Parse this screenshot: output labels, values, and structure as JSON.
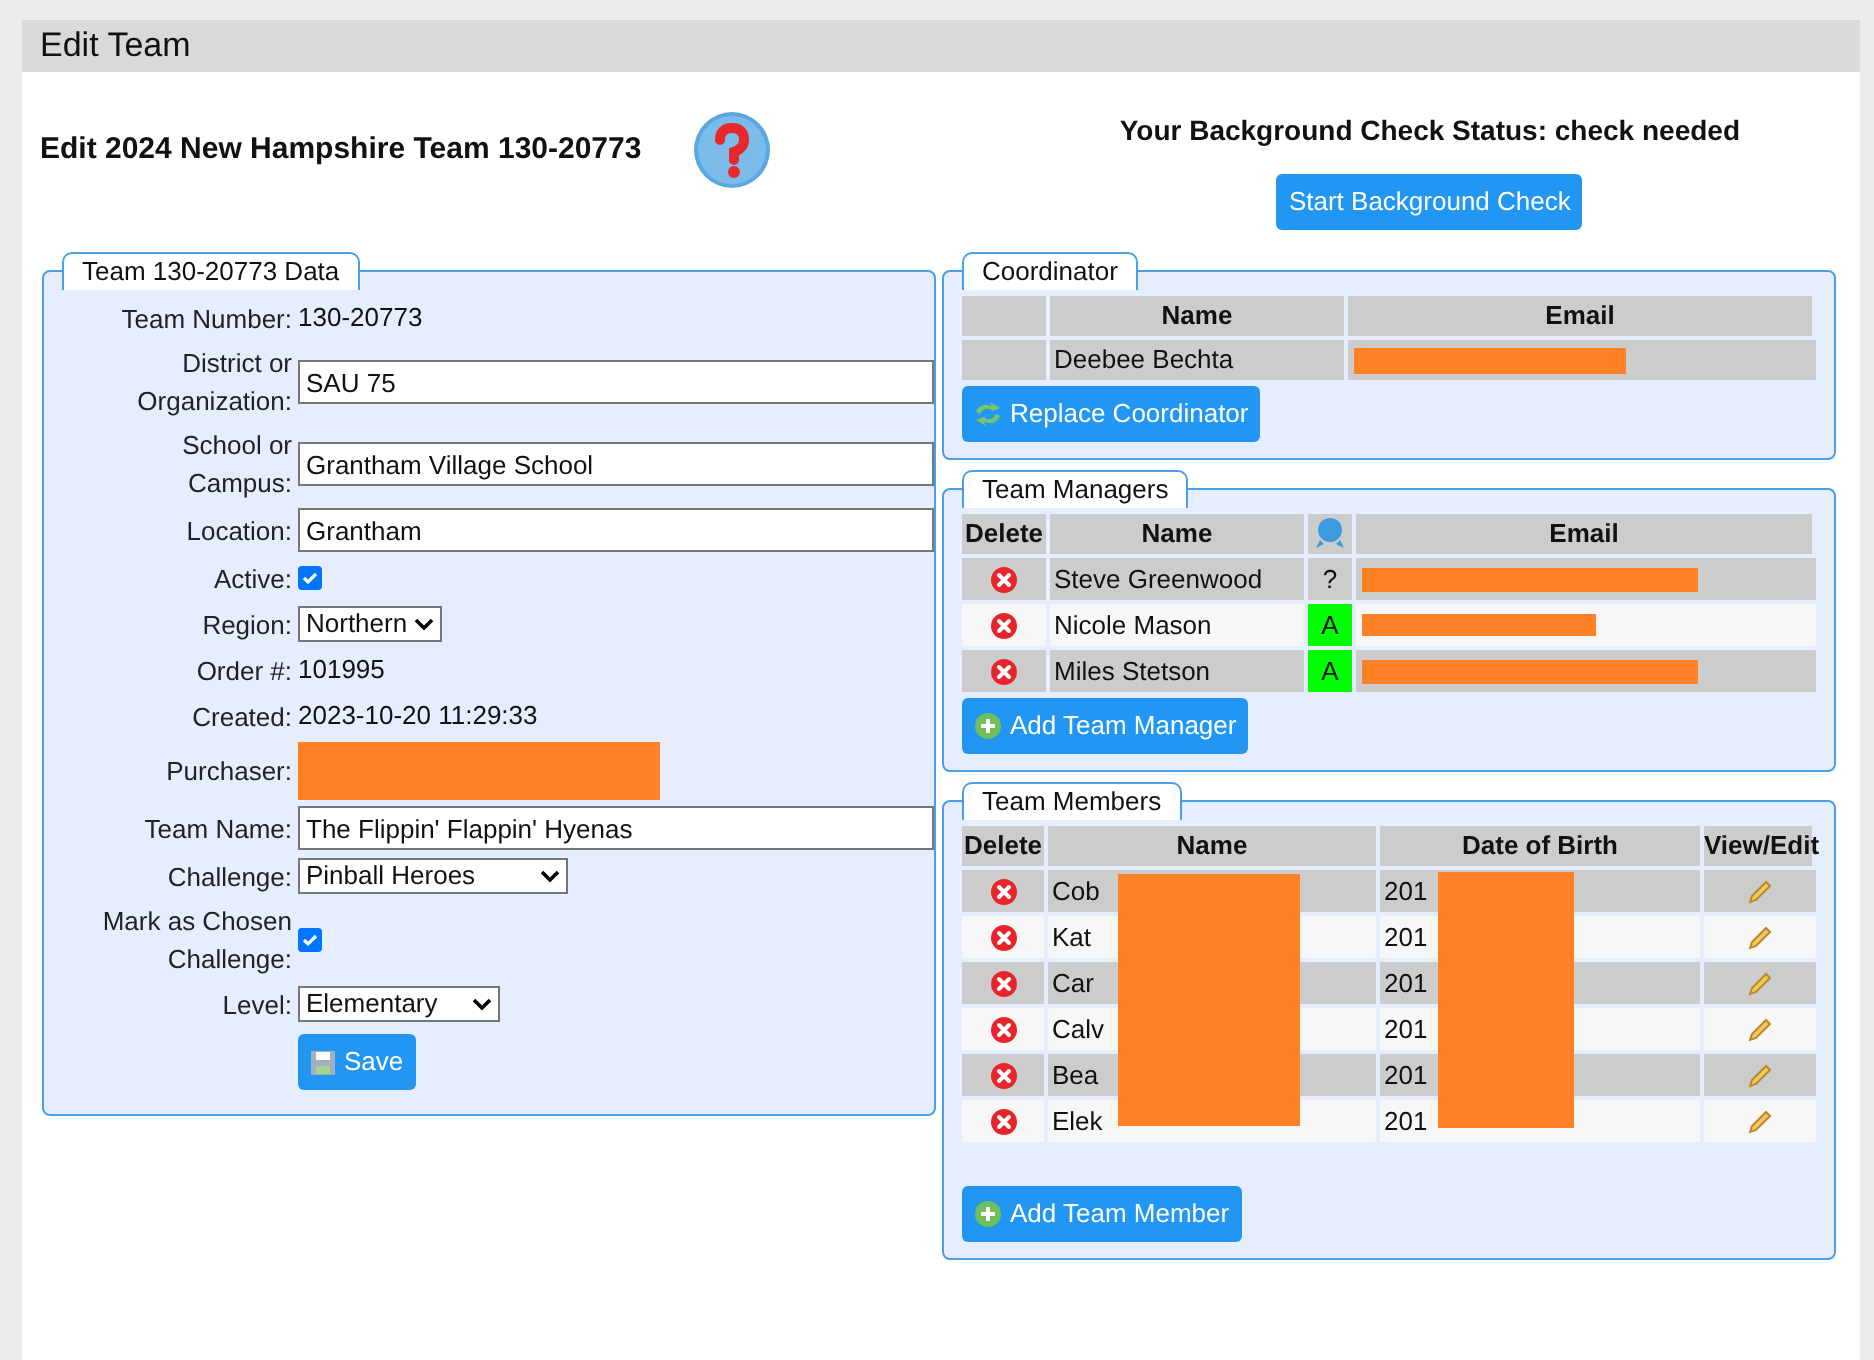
{
  "page_title": "Edit Team",
  "heading": "Edit 2024 New Hampshire Team 130-20773",
  "background_check": {
    "status_text": "Your Background Check Status: check needed",
    "button": "Start Background Check"
  },
  "team_data": {
    "legend": "Team 130-20773 Data",
    "fields": [
      {
        "kind": "text",
        "label": "Team Number:",
        "value": "130-20773"
      },
      {
        "kind": "input",
        "label": "District or Organization:",
        "value": "SAU 75"
      },
      {
        "kind": "input",
        "label": "School or Campus:",
        "value": "Grantham Village School"
      },
      {
        "kind": "input",
        "label": "Location:",
        "value": "Grantham"
      },
      {
        "kind": "checkbox",
        "label": "Active:",
        "checked": true
      },
      {
        "kind": "select",
        "label": "Region:",
        "value": "Northern"
      },
      {
        "kind": "text",
        "label": "Order #:",
        "value": "101995"
      },
      {
        "kind": "text",
        "label": "Created:",
        "value": "2023-10-20 11:29:33"
      },
      {
        "kind": "redacted",
        "label": "Purchaser:"
      },
      {
        "kind": "input",
        "label": "Team Name:",
        "value": "The Flippin' Flappin' Hyenas"
      },
      {
        "kind": "select",
        "label": "Challenge:",
        "value": "Pinball Heroes"
      },
      {
        "kind": "checkbox",
        "label": "Mark as Chosen Challenge:",
        "checked": true
      },
      {
        "kind": "select",
        "label": "Level:",
        "value": "Elementary"
      }
    ],
    "save_button": "Save"
  },
  "coordinator": {
    "legend": "Coordinator",
    "columns": [
      "Name",
      "Email"
    ],
    "name": "Deebee Bechta",
    "button": "Replace Coordinator"
  },
  "team_managers": {
    "legend": "Team Managers",
    "columns": [
      "Delete",
      "Name",
      "Email"
    ],
    "rows": [
      {
        "name": "Steve Greenwood",
        "clearance": "?",
        "cleared": false
      },
      {
        "name": "Nicole Mason",
        "clearance": "A",
        "cleared": true
      },
      {
        "name": "Miles Stetson",
        "clearance": "A",
        "cleared": true
      }
    ],
    "button": "Add Team Manager"
  },
  "team_members": {
    "legend": "Team Members",
    "columns": [
      "Delete",
      "Name",
      "Date of Birth",
      "View/Edit"
    ],
    "rows": [
      {
        "name": "Cob",
        "birth": "201"
      },
      {
        "name": "Kat",
        "birth": "201"
      },
      {
        "name": "Car",
        "birth": "201"
      },
      {
        "name": "Calv",
        "birth": "201"
      },
      {
        "name": "Bea",
        "birth": "201"
      },
      {
        "name": "Elek",
        "birth": "201"
      }
    ],
    "button": "Add Team Member"
  }
}
